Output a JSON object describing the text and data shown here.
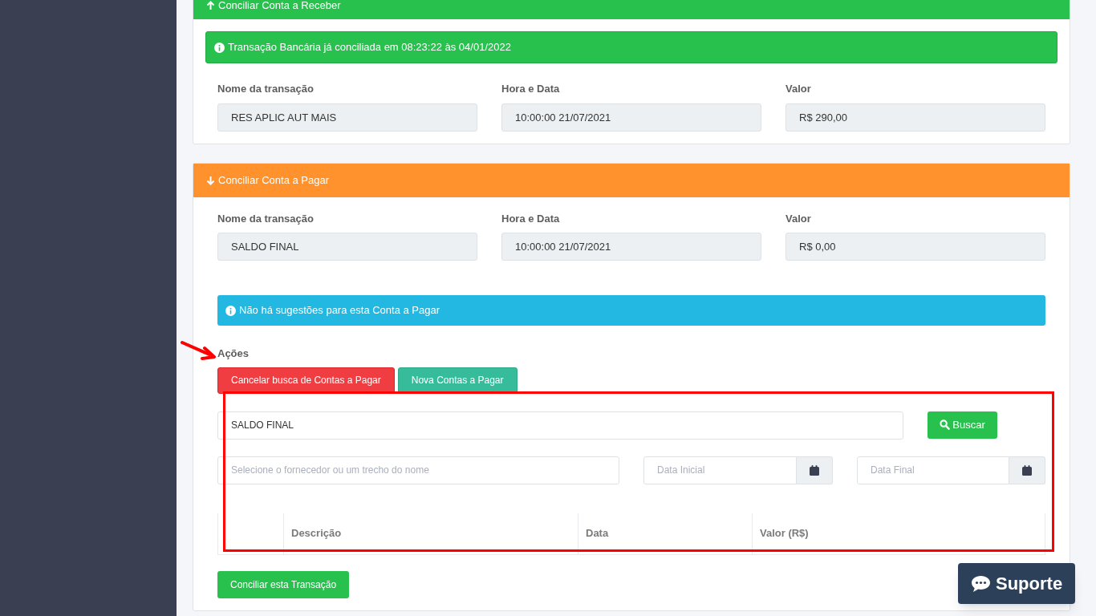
{
  "receber": {
    "title": "Conciliar Conta a Receber",
    "alert": "Transação Bancária já conciliada em 08:23:22 às 04/01/2022",
    "fields": [
      {
        "label": "Nome da transação",
        "value": "RES APLIC AUT MAIS"
      },
      {
        "label": "Hora e Data",
        "value": "10:00:00 21/07/2021"
      },
      {
        "label": "Valor",
        "value": "R$ 290,00"
      }
    ]
  },
  "pagar": {
    "title": "Conciliar Conta a Pagar",
    "fields": [
      {
        "label": "Nome da transação",
        "value": "SALDO FINAL"
      },
      {
        "label": "Hora e Data",
        "value": "10:00:00 21/07/2021"
      },
      {
        "label": "Valor",
        "value": "R$ 0,00"
      }
    ],
    "alert": "Não há sugestões para esta Conta a Pagar",
    "actions_label": "Ações",
    "actions": [
      {
        "label": "Cancelar busca de Contas a Pagar",
        "kind": "danger"
      },
      {
        "label": "Nova Contas a Pagar",
        "kind": "teal"
      }
    ],
    "search": {
      "value": "SALDO FINAL",
      "button": "Buscar"
    },
    "supplier": {
      "placeholder": "Selecione o fornecedor ou um trecho do nome"
    },
    "date_start": {
      "placeholder": "Data Inicial"
    },
    "date_end": {
      "placeholder": "Data Final"
    },
    "table": {
      "columns": [
        "Descrição",
        "Data",
        "Valor (R$)"
      ]
    },
    "submit": "Conciliar esta Transação"
  },
  "support_button": "Suporte"
}
